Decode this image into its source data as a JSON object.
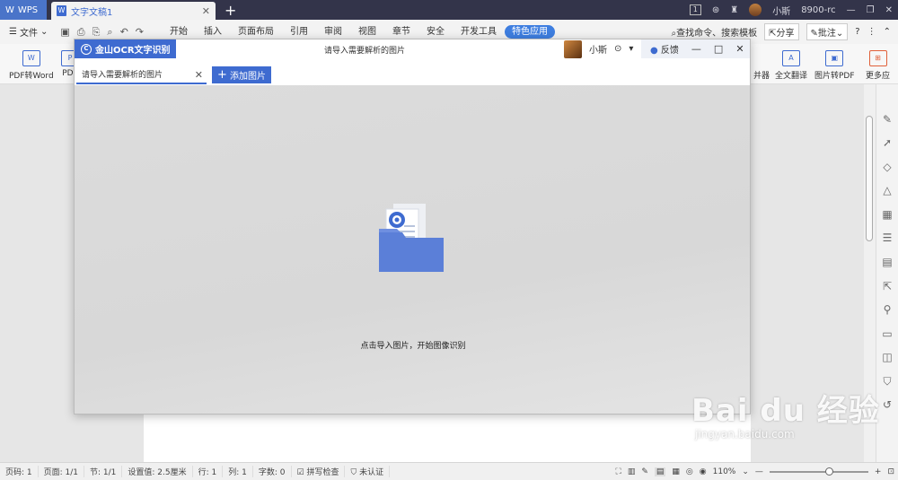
{
  "titlebar": {
    "app_label": "WPS",
    "doc_tab": "文字文稿1",
    "user": "小斯",
    "version": "8900-rc",
    "tab_count": "1"
  },
  "menubar": {
    "file_label": "文件",
    "tabs": [
      "开始",
      "插入",
      "页面布局",
      "引用",
      "审阅",
      "视图",
      "章节",
      "安全",
      "开发工具",
      "特色应用"
    ],
    "search": "查找命令、搜索模板",
    "share": "分享",
    "comment": "批注"
  },
  "ribbon": {
    "pdf_word": "PDF转Word",
    "pdf_cut": "PDF",
    "merge_cut": "并器",
    "translate": "全文翻译",
    "img_pdf": "图片转PDF",
    "more": "更多应"
  },
  "ocr": {
    "brand": "金山OCR文字识别",
    "title": "请导入需要解析的图片",
    "user": "小斯",
    "feedback": "反馈",
    "tab_label": "请导入需要解析的图片",
    "add_button": "添加图片",
    "hint": "点击导入图片，开始图像识别"
  },
  "statusbar": {
    "page_no": "页码: 1",
    "pages": "页面: 1/1",
    "section": "节: 1/1",
    "setting": "设置值: 2.5厘米",
    "row": "行: 1",
    "col": "列: 1",
    "words": "字数: 0",
    "spell": "拼写检查",
    "auth": "未认证",
    "zoom": "110%"
  },
  "watermark": {
    "brand": "Bai du 经验",
    "url": "jingyan.baidu.com"
  }
}
